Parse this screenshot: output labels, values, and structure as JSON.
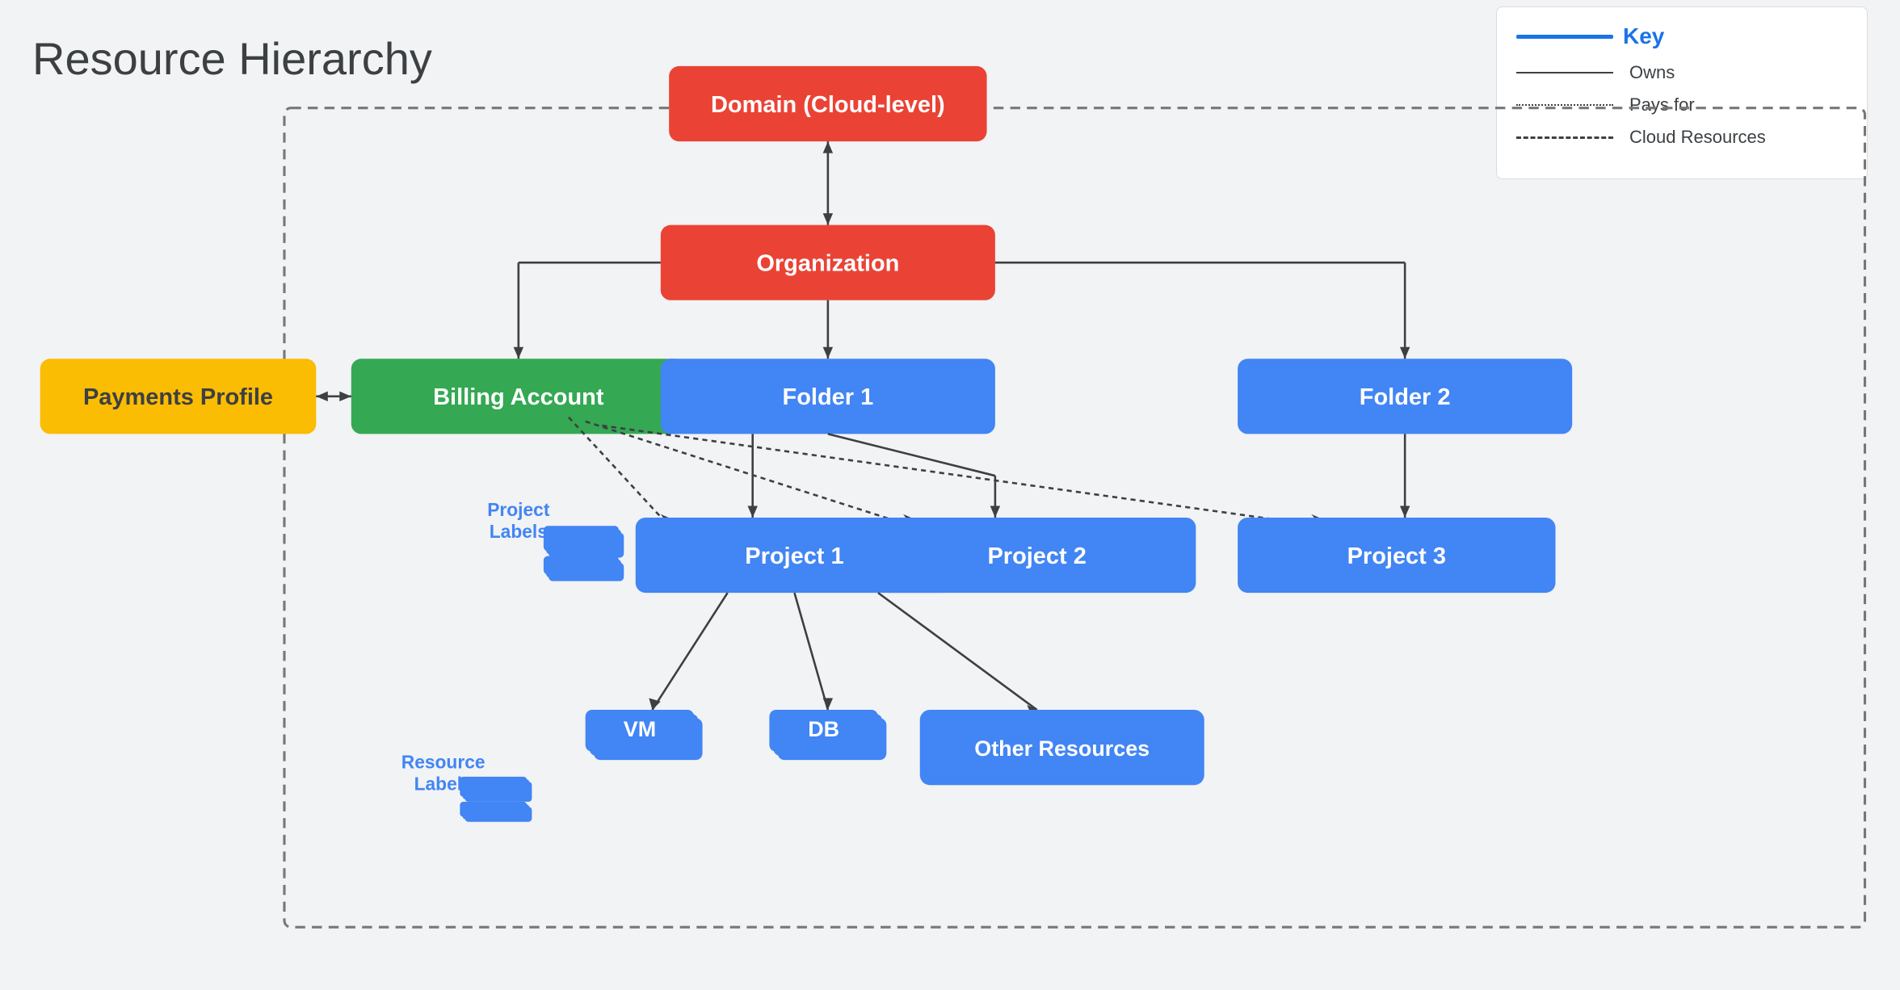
{
  "title": "Resource Hierarchy",
  "key": {
    "title": "Key",
    "items": [
      {
        "label": "Owns",
        "type": "solid"
      },
      {
        "label": "Pays for",
        "type": "dotted"
      },
      {
        "label": "Cloud Resources",
        "type": "dashed"
      }
    ]
  },
  "nodes": {
    "domain": "Domain (Cloud-level)",
    "organization": "Organization",
    "payments_profile": "Payments Profile",
    "billing_account": "Billing Account",
    "folder1": "Folder 1",
    "folder2": "Folder 2",
    "project1": "Project 1",
    "project2": "Project 2",
    "project3": "Project 3",
    "vm": "VM",
    "db": "DB",
    "other_resources": "Other Resources"
  },
  "labels": {
    "project_labels": "Project\nLabels",
    "resource_labels": "Resource\nLabels"
  }
}
